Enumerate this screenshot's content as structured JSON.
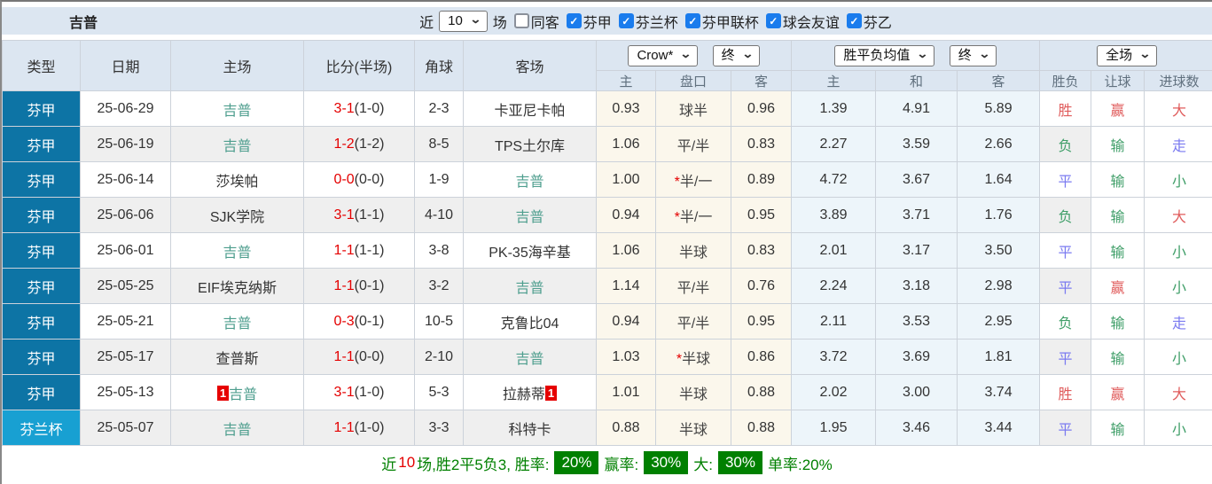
{
  "topbar": {
    "team": "吉普",
    "near_label": "近",
    "count_value": "10",
    "games_label": "场",
    "filters": [
      {
        "label": "同客",
        "checked": false
      },
      {
        "label": "芬甲",
        "checked": true
      },
      {
        "label": "芬兰杯",
        "checked": true
      },
      {
        "label": "芬甲联杯",
        "checked": true
      },
      {
        "label": "球会友谊",
        "checked": true
      },
      {
        "label": "芬乙",
        "checked": true
      }
    ]
  },
  "header": {
    "cols": [
      "类型",
      "日期",
      "主场",
      "比分(半场)",
      "角球",
      "客场"
    ],
    "book_select": "Crow*",
    "time_select1": "终",
    "mean_select": "胜平负均值",
    "time_select2": "终",
    "scope_select": "全场",
    "subcols": [
      "主",
      "盘口",
      "客",
      "主",
      "和",
      "客",
      "胜负",
      "让球",
      "进球数"
    ]
  },
  "rows": [
    {
      "league": "芬甲",
      "lg": 1,
      "date": "25-06-29",
      "home": "吉普",
      "home_green": true,
      "home_card": "",
      "score": "3-1",
      "half": "(1-0)",
      "corner": "2-3",
      "away": "卡亚尼卡帕",
      "away_green": false,
      "away_card": "",
      "o1": "0.93",
      "star": false,
      "pan": "球半",
      "o2": "0.96",
      "m1": "1.39",
      "m2": "4.91",
      "m3": "5.89",
      "res": "胜",
      "res_c": "r",
      "rq": "赢",
      "rq_c": "r",
      "jq": "大",
      "jq_c": "r"
    },
    {
      "league": "芬甲",
      "lg": 1,
      "date": "25-06-19",
      "home": "吉普",
      "home_green": true,
      "home_card": "",
      "score": "1-2",
      "half": "(1-2)",
      "corner": "8-5",
      "away": "TPS土尔库",
      "away_green": false,
      "away_card": "",
      "o1": "1.06",
      "star": false,
      "pan": "平/半",
      "o2": "0.83",
      "m1": "2.27",
      "m2": "3.59",
      "m3": "2.66",
      "res": "负",
      "res_c": "g",
      "rq": "输",
      "rq_c": "g",
      "jq": "走",
      "jq_c": "b"
    },
    {
      "league": "芬甲",
      "lg": 1,
      "date": "25-06-14",
      "home": "莎埃帕",
      "home_green": false,
      "home_card": "",
      "score": "0-0",
      "half": "(0-0)",
      "corner": "1-9",
      "away": "吉普",
      "away_green": true,
      "away_card": "",
      "o1": "1.00",
      "star": true,
      "pan": "半/一",
      "o2": "0.89",
      "m1": "4.72",
      "m2": "3.67",
      "m3": "1.64",
      "res": "平",
      "res_c": "b",
      "rq": "输",
      "rq_c": "g",
      "jq": "小",
      "jq_c": "g"
    },
    {
      "league": "芬甲",
      "lg": 1,
      "date": "25-06-06",
      "home": "SJK学院",
      "home_green": false,
      "home_card": "",
      "score": "3-1",
      "half": "(1-1)",
      "corner": "4-10",
      "away": "吉普",
      "away_green": true,
      "away_card": "",
      "o1": "0.94",
      "star": true,
      "pan": "半/一",
      "o2": "0.95",
      "m1": "3.89",
      "m2": "3.71",
      "m3": "1.76",
      "res": "负",
      "res_c": "g",
      "rq": "输",
      "rq_c": "g",
      "jq": "大",
      "jq_c": "r"
    },
    {
      "league": "芬甲",
      "lg": 1,
      "date": "25-06-01",
      "home": "吉普",
      "home_green": true,
      "home_card": "",
      "score": "1-1",
      "half": "(1-1)",
      "corner": "3-8",
      "away": "PK-35海辛基",
      "away_green": false,
      "away_card": "",
      "o1": "1.06",
      "star": false,
      "pan": "半球",
      "o2": "0.83",
      "m1": "2.01",
      "m2": "3.17",
      "m3": "3.50",
      "res": "平",
      "res_c": "b",
      "rq": "输",
      "rq_c": "g",
      "jq": "小",
      "jq_c": "g"
    },
    {
      "league": "芬甲",
      "lg": 1,
      "date": "25-05-25",
      "home": "EIF埃克纳斯",
      "home_green": false,
      "home_card": "",
      "score": "1-1",
      "half": "(0-1)",
      "corner": "3-2",
      "away": "吉普",
      "away_green": true,
      "away_card": "",
      "o1": "1.14",
      "star": false,
      "pan": "平/半",
      "o2": "0.76",
      "m1": "2.24",
      "m2": "3.18",
      "m3": "2.98",
      "res": "平",
      "res_c": "b",
      "rq": "赢",
      "rq_c": "r",
      "jq": "小",
      "jq_c": "g"
    },
    {
      "league": "芬甲",
      "lg": 1,
      "date": "25-05-21",
      "home": "吉普",
      "home_green": true,
      "home_card": "",
      "score": "0-3",
      "half": "(0-1)",
      "corner": "10-5",
      "away": "克鲁比04",
      "away_green": false,
      "away_card": "",
      "o1": "0.94",
      "star": false,
      "pan": "平/半",
      "o2": "0.95",
      "m1": "2.11",
      "m2": "3.53",
      "m3": "2.95",
      "res": "负",
      "res_c": "g",
      "rq": "输",
      "rq_c": "g",
      "jq": "走",
      "jq_c": "b"
    },
    {
      "league": "芬甲",
      "lg": 1,
      "date": "25-05-17",
      "home": "查普斯",
      "home_green": false,
      "home_card": "",
      "score": "1-1",
      "half": "(0-0)",
      "corner": "2-10",
      "away": "吉普",
      "away_green": true,
      "away_card": "",
      "o1": "1.03",
      "star": true,
      "pan": "半球",
      "o2": "0.86",
      "m1": "3.72",
      "m2": "3.69",
      "m3": "1.81",
      "res": "平",
      "res_c": "b",
      "rq": "输",
      "rq_c": "g",
      "jq": "小",
      "jq_c": "g"
    },
    {
      "league": "芬甲",
      "lg": 1,
      "date": "25-05-13",
      "home": "吉普",
      "home_green": true,
      "home_card": "1",
      "score": "3-1",
      "half": "(1-0)",
      "corner": "5-3",
      "away": "拉赫蒂",
      "away_green": false,
      "away_card": "1",
      "o1": "1.01",
      "star": false,
      "pan": "半球",
      "o2": "0.88",
      "m1": "2.02",
      "m2": "3.00",
      "m3": "3.74",
      "res": "胜",
      "res_c": "r",
      "rq": "赢",
      "rq_c": "r",
      "jq": "大",
      "jq_c": "r"
    },
    {
      "league": "芬兰杯",
      "lg": 2,
      "date": "25-05-07",
      "home": "吉普",
      "home_green": true,
      "home_card": "",
      "score": "1-1",
      "half": "(1-0)",
      "corner": "3-3",
      "away": "科特卡",
      "away_green": false,
      "away_card": "",
      "o1": "0.88",
      "star": false,
      "pan": "半球",
      "o2": "0.88",
      "m1": "1.95",
      "m2": "3.46",
      "m3": "3.44",
      "res": "平",
      "res_c": "b",
      "rq": "输",
      "rq_c": "g",
      "jq": "小",
      "jq_c": "g"
    }
  ],
  "footer": {
    "segments": [
      {
        "text": "近",
        "style": "green"
      },
      {
        "text": "10",
        "style": "red"
      },
      {
        "text": "场,胜2平5负3, 胜率:",
        "style": "green"
      },
      {
        "text": "20%",
        "style": "badge"
      },
      {
        "text": "赢率:",
        "style": "green"
      },
      {
        "text": "30%",
        "style": "badge"
      },
      {
        "text": "大:",
        "style": "green"
      },
      {
        "text": "30%",
        "style": "badge"
      },
      {
        "text": "单率:20%",
        "style": "green"
      }
    ]
  },
  "colors": {
    "header_bg": "#dce6f1",
    "league_main_bg": "#0d74a5",
    "cup_bg": "#18a0d2",
    "stripe_bg": "#efefef",
    "odds_bg": "#fbf7ec",
    "mean_bg": "#edf5fa",
    "team_green": "#4e9e8e",
    "score_red": "#e40000",
    "win_red": "#e05c5c",
    "draw_blue": "#7a7af0",
    "lose_green": "#3f9e68",
    "footer_green": "#008000",
    "checkbox_blue": "#1a7ced",
    "card_red": "#e60000"
  }
}
